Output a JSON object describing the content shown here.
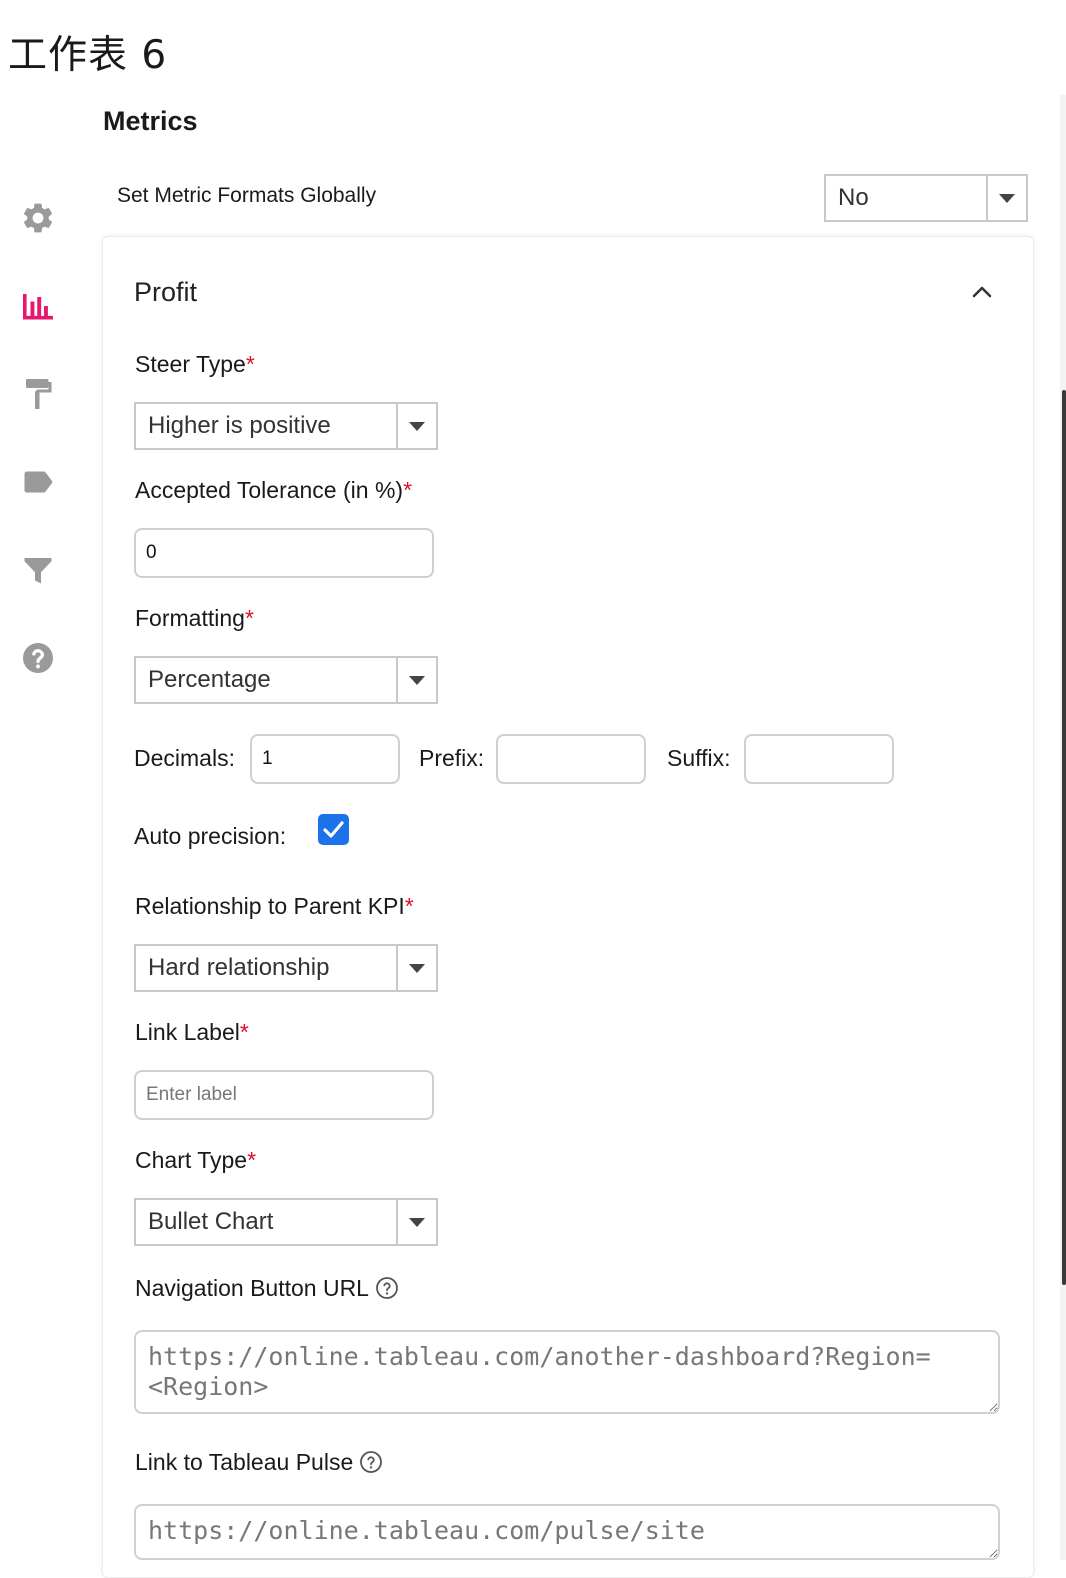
{
  "window": {
    "title": "工作表 6"
  },
  "sidebar": {
    "active_color": "#e6186e",
    "icon_color": "#9a9a9a",
    "items": [
      {
        "icon": "gear-icon",
        "active": false
      },
      {
        "icon": "bar-chart-icon",
        "active": true
      },
      {
        "icon": "paint-roller-icon",
        "active": false
      },
      {
        "icon": "tag-icon",
        "active": false
      },
      {
        "icon": "filter-icon",
        "active": false
      },
      {
        "icon": "help-icon",
        "active": false
      }
    ]
  },
  "section": {
    "title": "Metrics",
    "global_formats_label": "Set Metric Formats Globally",
    "global_formats_value": "No"
  },
  "metric": {
    "name": "Profit",
    "steer_type": {
      "label": "Steer Type",
      "required": "*",
      "value": "Higher is positive"
    },
    "tolerance": {
      "label": "Accepted Tolerance (in %)",
      "required": "*",
      "value": "0"
    },
    "formatting": {
      "label": "Formatting",
      "required": "*",
      "value": "Percentage"
    },
    "decimals": {
      "label": "Decimals:",
      "value": "1"
    },
    "prefix": {
      "label": "Prefix:",
      "value": ""
    },
    "suffix": {
      "label": "Suffix:",
      "value": ""
    },
    "auto_precision": {
      "label": "Auto precision:",
      "checked": true
    },
    "relationship": {
      "label": "Relationship to Parent KPI",
      "required": "*",
      "value": "Hard relationship"
    },
    "link_label": {
      "label": "Link Label",
      "required": "*",
      "placeholder": "Enter label",
      "value": ""
    },
    "chart_type": {
      "label": "Chart Type",
      "required": "*",
      "value": "Bullet Chart"
    },
    "nav_url": {
      "label": "Navigation Button URL",
      "placeholder": "https://online.tableau.com/another-dashboard?Region=<Region>"
    },
    "pulse_link": {
      "label": "Link to Tableau Pulse",
      "placeholder": "https://online.tableau.com/pulse/site"
    }
  },
  "colors": {
    "accent": "#e6186e",
    "checkbox": "#1a73e8",
    "required": "#e01020"
  }
}
